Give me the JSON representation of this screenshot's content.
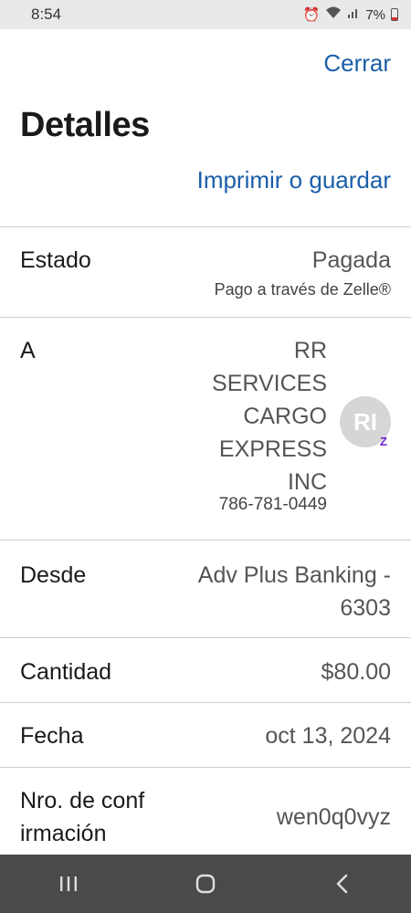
{
  "status_bar": {
    "time": "8:54",
    "battery": "7%"
  },
  "header": {
    "close_label": "Cerrar",
    "title": "Detalles",
    "print_label": "Imprimir o guardar"
  },
  "details": {
    "status": {
      "label": "Estado",
      "value": "Pagada",
      "sub": "Pago a través de Zelle®"
    },
    "to": {
      "label": "A",
      "name_lines": [
        "RR",
        "SERVICES",
        "CARGO",
        "EXPRESS",
        "INC"
      ],
      "phone": "786-781-0449",
      "avatar_initials": "RI",
      "badge": "Z"
    },
    "from": {
      "label": "Desde",
      "value_lines": [
        "Adv Plus Banking -",
        "6303"
      ]
    },
    "amount": {
      "label": "Cantidad",
      "value": "$80.00"
    },
    "date": {
      "label": "Fecha",
      "value": "oct 13, 2024"
    },
    "confirmation": {
      "label_lines": [
        "Nro. de conf",
        "irmación"
      ],
      "value": "wen0q0vyz"
    }
  },
  "nav": {
    "icons": [
      "recent-apps-icon",
      "home-icon",
      "back-icon"
    ]
  },
  "colors": {
    "link": "#1a5fa8",
    "zelle": "#6d1ed4",
    "navbar": "#4a4a4a"
  }
}
